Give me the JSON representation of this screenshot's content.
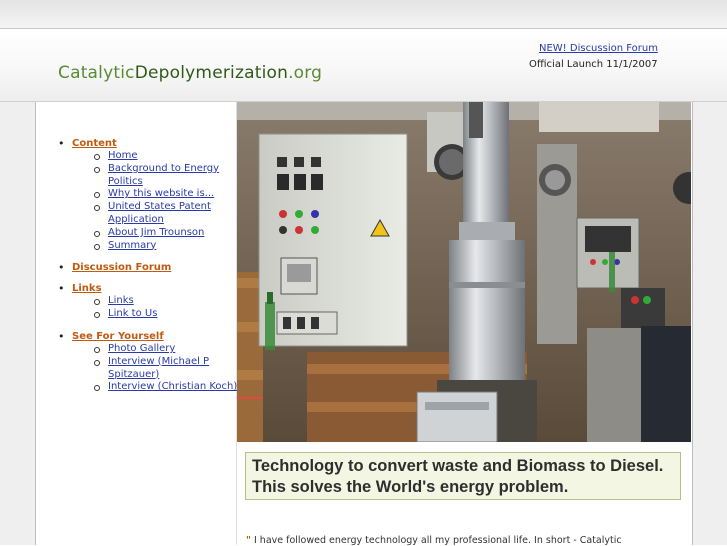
{
  "site": {
    "logo_part1": "Catalytic",
    "logo_part2": "Depolymerization",
    "logo_part3": ".org"
  },
  "header": {
    "forum_link": "NEW! Discussion Forum",
    "launch_text": "Official Launch 11/1/2007"
  },
  "sidebar": {
    "sections": [
      {
        "label": "Content",
        "items": [
          "Home",
          "Background to Energy Politics",
          "Why this website is...",
          "United States Patent Application",
          "About Jim Trounson",
          "Summary"
        ]
      },
      {
        "label": "Discussion Forum",
        "items": []
      },
      {
        "label": "Links",
        "items": [
          "Links",
          "Link to Us"
        ]
      },
      {
        "label": "See For Yourself",
        "items": [
          "Photo Gallery",
          "Interview (Michael P Spitzauer)",
          "Interview (Christian Koch)"
        ]
      }
    ]
  },
  "main": {
    "tagline": "Technology to convert waste and Biomass to Diesel. This solves the World's energy problem.",
    "quote_mark": "\"",
    "quote_text": " I have followed energy technology all my professional life. In short - Catalytic"
  },
  "colors": {
    "logo_green": "#4a7a2a",
    "menu_orange": "#c25a10",
    "link_blue": "#2a3aa8"
  }
}
